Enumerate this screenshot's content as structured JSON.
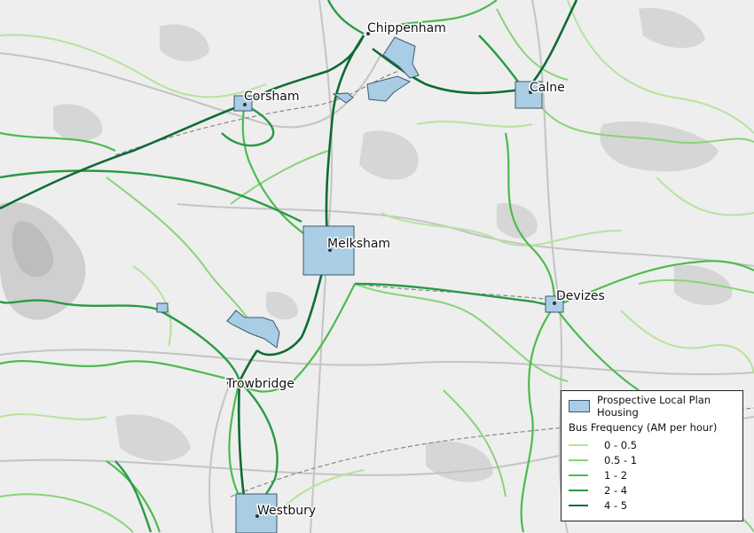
{
  "map": {
    "towns": [
      {
        "id": "chippenham",
        "label": "Chippenham"
      },
      {
        "id": "corsham",
        "label": "Corsham"
      },
      {
        "id": "calne",
        "label": "Calne"
      },
      {
        "id": "melksham",
        "label": "Melksham"
      },
      {
        "id": "devizes",
        "label": "Devizes"
      },
      {
        "id": "trowbridge",
        "label": "Trowbridge"
      },
      {
        "id": "westbury",
        "label": "Westbury"
      }
    ],
    "colors": {
      "background": "#eeeeee",
      "housing_fill": "#a9cde4",
      "housing_stroke": "#3a5a70"
    }
  },
  "legend": {
    "housing_label": "Prospective Local Plan Housing",
    "bus_title": "Bus Frequency (AM per hour)",
    "classes": [
      {
        "label": "0 - 0.5",
        "color": "#b6e39c"
      },
      {
        "label": "0.5 - 1",
        "color": "#8ad27a"
      },
      {
        "label": "1 - 2",
        "color": "#4cbb4c"
      },
      {
        "label": "2 - 4",
        "color": "#2a9a45"
      },
      {
        "label": "4 - 5",
        "color": "#0e6b35"
      }
    ]
  }
}
